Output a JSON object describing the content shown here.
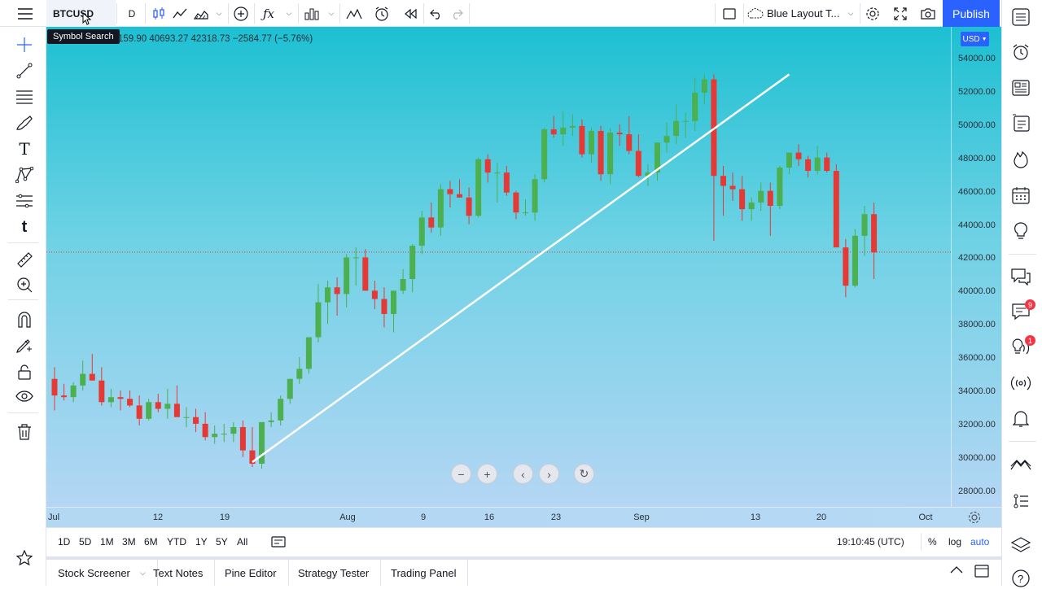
{
  "top": {
    "symbol": "BTCUSD",
    "interval": "D",
    "layout_name": "Blue Layout T...",
    "publish": "Publish",
    "tooltip": "Symbol Search"
  },
  "legend": {
    "ohlc": "159.90  40693.27  42318.73  −2584.77 (−5.76%)"
  },
  "currency": "USD",
  "price_labels": [
    "54000.00",
    "52000.00",
    "50000.00",
    "48000.00",
    "46000.00",
    "44000.00",
    "42000.00",
    "40000.00",
    "38000.00",
    "36000.00",
    "34000.00",
    "32000.00",
    "30000.00",
    "28000.00"
  ],
  "time_labels": [
    "Jul",
    "12",
    "19",
    "Aug",
    "9",
    "16",
    "23",
    "Sep",
    "13",
    "20",
    "Oct"
  ],
  "ranges": [
    "1D",
    "5D",
    "1M",
    "3M",
    "6M",
    "YTD",
    "1Y",
    "5Y",
    "All"
  ],
  "clock": "19:10:45 (UTC)",
  "scale_options": [
    "%",
    "log",
    "auto"
  ],
  "panels": [
    "Stock Screener",
    "Text Notes",
    "Pine Editor",
    "Strategy Tester",
    "Trading Panel"
  ],
  "badges": {
    "ideas": "9",
    "streams": "1"
  },
  "colors": {
    "up": "#4caf50",
    "down": "#e53935",
    "accent": "#2962ff"
  },
  "chart_data": {
    "type": "candlestick",
    "symbol": "BTCUSD",
    "ylim": [
      27000,
      55000
    ],
    "series_order": [
      "open",
      "high",
      "low",
      "close"
    ],
    "candles": [
      [
        34700,
        35400,
        32800,
        33700
      ],
      [
        33700,
        34400,
        33400,
        33600
      ],
      [
        33600,
        34500,
        33300,
        34300
      ],
      [
        34300,
        35800,
        34000,
        35000
      ],
      [
        35000,
        36200,
        34600,
        34600
      ],
      [
        34600,
        35400,
        33100,
        33300
      ],
      [
        33300,
        34100,
        33000,
        33600
      ],
      [
        33600,
        34000,
        32800,
        33500
      ],
      [
        33500,
        34000,
        33000,
        33100
      ],
      [
        33100,
        33700,
        31900,
        32300
      ],
      [
        32300,
        33500,
        32200,
        33300
      ],
      [
        33300,
        33800,
        32700,
        32900
      ],
      [
        32900,
        34100,
        32300,
        33200
      ],
      [
        33200,
        34300,
        32800,
        32400
      ],
      [
        32400,
        33000,
        31800,
        32400
      ],
      [
        32400,
        32900,
        31500,
        32000
      ],
      [
        32000,
        32700,
        31000,
        31200
      ],
      [
        31200,
        31900,
        30800,
        31400
      ],
      [
        31400,
        32000,
        30900,
        31400
      ],
      [
        31400,
        32100,
        30900,
        31800
      ],
      [
        31800,
        32200,
        30000,
        30400
      ],
      [
        30400,
        31800,
        29400,
        29600
      ],
      [
        29600,
        32000,
        29300,
        32100
      ],
      [
        32100,
        32700,
        31800,
        32200
      ],
      [
        32200,
        33700,
        31900,
        33500
      ],
      [
        33500,
        34700,
        33200,
        34700
      ],
      [
        34700,
        36000,
        34400,
        35300
      ],
      [
        35300,
        37200,
        35000,
        37200
      ],
      [
        37200,
        40400,
        36900,
        39300
      ],
      [
        39300,
        40600,
        38000,
        40200
      ],
      [
        40200,
        40800,
        38500,
        39800
      ],
      [
        39800,
        42200,
        39000,
        42000
      ],
      [
        42000,
        42600,
        40300,
        42000
      ],
      [
        42000,
        42500,
        40000,
        40000
      ],
      [
        40000,
        40600,
        38900,
        39500
      ],
      [
        39500,
        40200,
        37800,
        38600
      ],
      [
        38600,
        40000,
        37500,
        40000
      ],
      [
        40000,
        41300,
        39800,
        40700
      ],
      [
        40700,
        42800,
        39900,
        42700
      ],
      [
        42700,
        44800,
        42200,
        44400
      ],
      [
        44400,
        45300,
        43500,
        43800
      ],
      [
        43800,
        46400,
        43300,
        46100
      ],
      [
        46100,
        46600,
        45000,
        45800
      ],
      [
        45800,
        46700,
        45600,
        45600
      ],
      [
        45600,
        46200,
        44000,
        44500
      ],
      [
        44500,
        48000,
        44400,
        47900
      ],
      [
        47900,
        48200,
        46500,
        47100
      ],
      [
        47100,
        47700,
        45300,
        47100
      ],
      [
        47100,
        47500,
        45700,
        45900
      ],
      [
        45900,
        46000,
        44300,
        44700
      ],
      [
        44700,
        45500,
        44500,
        44700
      ],
      [
        44700,
        47000,
        44200,
        46700
      ],
      [
        46700,
        49800,
        46500,
        49700
      ],
      [
        49700,
        50500,
        49200,
        49400
      ],
      [
        49400,
        50800,
        48700,
        49800
      ],
      [
        49800,
        50600,
        49300,
        49900
      ],
      [
        49900,
        50300,
        48000,
        48200
      ],
      [
        48200,
        49800,
        47700,
        49600
      ],
      [
        49600,
        49900,
        46600,
        47000
      ],
      [
        47000,
        49800,
        46400,
        49500
      ],
      [
        49500,
        50000,
        48700,
        49400
      ],
      [
        49400,
        50500,
        48200,
        48400
      ],
      [
        48400,
        49400,
        46800,
        46900
      ],
      [
        46900,
        47600,
        46300,
        47100
      ],
      [
        47100,
        48900,
        46600,
        48900
      ],
      [
        48900,
        50100,
        48300,
        49300
      ],
      [
        49300,
        51200,
        48800,
        50200
      ],
      [
        50200,
        50700,
        49200,
        50200
      ],
      [
        50200,
        52800,
        49600,
        51900
      ],
      [
        51900,
        53000,
        51200,
        52700
      ],
      [
        52700,
        53000,
        43000,
        46900
      ],
      [
        46900,
        47500,
        44500,
        46300
      ],
      [
        46300,
        47100,
        45400,
        46100
      ],
      [
        46100,
        46900,
        44200,
        44900
      ],
      [
        44900,
        45600,
        44200,
        45300
      ],
      [
        45300,
        46500,
        44800,
        46000
      ],
      [
        46000,
        46500,
        43300,
        45100
      ],
      [
        45100,
        47500,
        44900,
        47400
      ],
      [
        47400,
        48300,
        47000,
        48300
      ],
      [
        48300,
        48800,
        47500,
        47900
      ],
      [
        47900,
        48100,
        46800,
        47200
      ],
      [
        47200,
        48700,
        47000,
        48000
      ],
      [
        48000,
        48300,
        47100,
        47200
      ],
      [
        47200,
        47600,
        42700,
        42600
      ],
      [
        42600,
        43100,
        39600,
        40300
      ],
      [
        40300,
        43700,
        40200,
        43300
      ],
      [
        43300,
        45100,
        42100,
        44600
      ],
      [
        44600,
        45300,
        40700,
        42300
      ]
    ],
    "trendline": {
      "from": [
        "2021-07-20",
        29700
      ],
      "to": [
        "2021-09-10",
        53000
      ]
    },
    "current_price": 42318.73
  }
}
